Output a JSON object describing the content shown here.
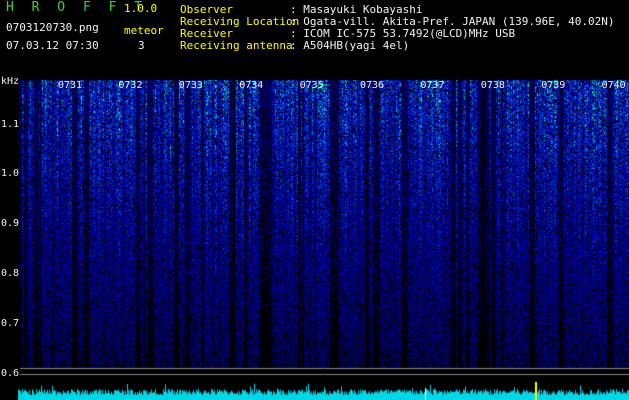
{
  "app": {
    "title": "H R O F F T",
    "version": "1.0.0"
  },
  "file": {
    "name": "0703120730.png",
    "datetime": "07.03.12 07:30"
  },
  "meteor": {
    "label": "meteor",
    "count": "3"
  },
  "meta": [
    {
      "key": "Observer",
      "value": ": Masayuki Kobayashi"
    },
    {
      "key": "Receiving Location",
      "value": ": Ogata-vill. Akita-Pref. JAPAN (139.96E, 40.02N)"
    },
    {
      "key": "Receiver",
      "value": ": ICOM IC-575 53.7492(@LCD)MHz USB"
    },
    {
      "key": "Receiving antenna",
      "value": ": A504HB(yagi 4el)"
    }
  ],
  "chart_data": {
    "type": "heatmap",
    "yunit": "kHz",
    "ytick_labels": [
      "1.1",
      "1.0",
      "0.9",
      "0.8",
      "0.7",
      "0.6"
    ],
    "xtick_labels": [
      "0731",
      "0732",
      "0733",
      "0734",
      "0735",
      "0736",
      "0737",
      "0738",
      "0739",
      "0740"
    ]
  },
  "colors": {
    "background": "#000000",
    "title": "#3cd13c",
    "header_value": "#ffff00",
    "spectrum_high": "#00e0e0",
    "marker": "#ffff00"
  }
}
